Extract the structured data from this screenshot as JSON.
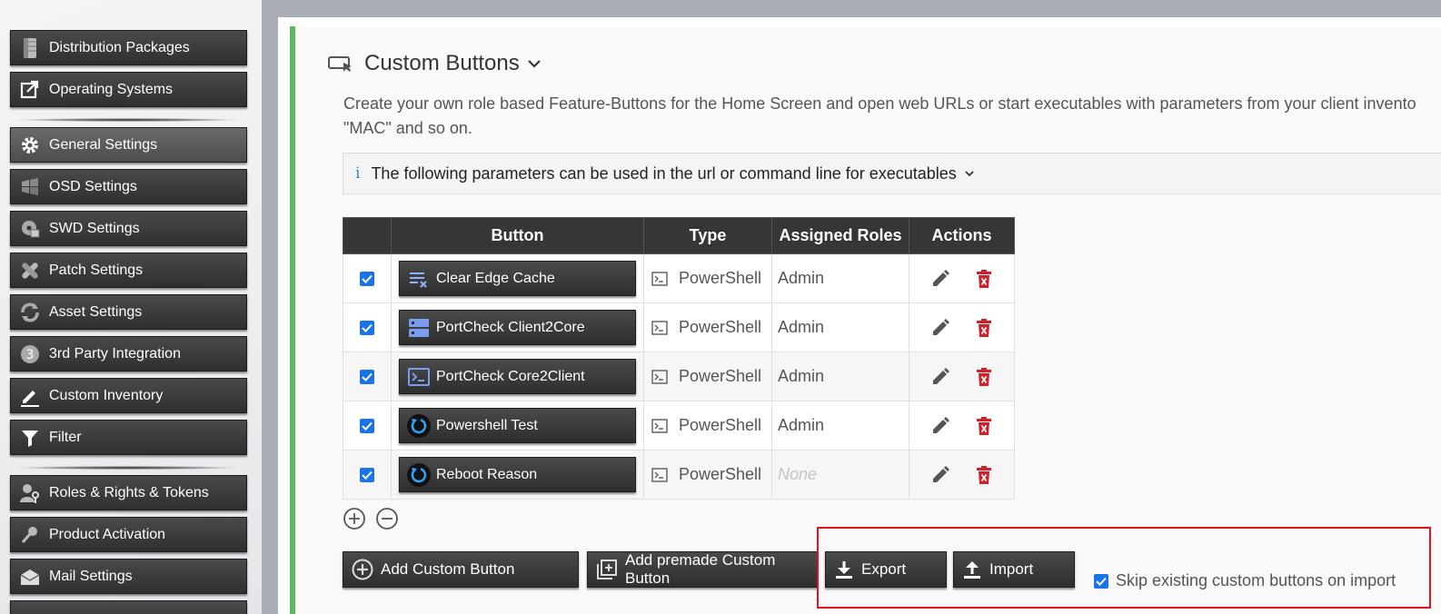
{
  "sidebar": {
    "items": [
      {
        "label": "Distribution Packages",
        "icon": "package-icon"
      },
      {
        "label": "Operating Systems",
        "icon": "external-link-icon"
      },
      {
        "label": "General Settings",
        "icon": "gear-icon"
      },
      {
        "label": "OSD Settings",
        "icon": "windows-logo-icon"
      },
      {
        "label": "SWD Settings",
        "icon": "disc-icon"
      },
      {
        "label": "Patch Settings",
        "icon": "bandage-icon"
      },
      {
        "label": "Asset Settings",
        "icon": "refresh-icon"
      },
      {
        "label": "3rd Party Integration",
        "icon": "number-three-icon"
      },
      {
        "label": "Custom Inventory",
        "icon": "pencil-icon"
      },
      {
        "label": "Filter",
        "icon": "filter-icon"
      },
      {
        "label": "Roles & Rights & Tokens",
        "icon": "user-key-icon"
      },
      {
        "label": "Product Activation",
        "icon": "key-icon"
      },
      {
        "label": "Mail Settings",
        "icon": "envelope-icon"
      }
    ]
  },
  "page": {
    "title": "Custom Buttons",
    "description_line1": "Create your own role based Feature-Buttons for the Home Screen and open web URLs or start executables with parameters from your client invento",
    "description_line2": "\"MAC\" and so on.",
    "info_text": "The following parameters can be used in the url or command line for executables",
    "info_glyph": "i"
  },
  "table": {
    "headers": [
      "",
      "Button",
      "Type",
      "Assigned Roles",
      "Actions"
    ],
    "rows": [
      {
        "button": "Clear Edge Cache",
        "icon": "clear-list-icon",
        "type": "PowerShell",
        "roles": "Admin"
      },
      {
        "button": "PortCheck Client2Core",
        "icon": "server-icon",
        "type": "PowerShell",
        "roles": "Admin"
      },
      {
        "button": "PortCheck Core2Client",
        "icon": "terminal-icon",
        "type": "PowerShell",
        "roles": "Admin"
      },
      {
        "button": "Powershell Test",
        "icon": "power-cycle-icon",
        "type": "PowerShell",
        "roles": "Admin"
      },
      {
        "button": "Reboot Reason",
        "icon": "power-cycle-icon",
        "type": "PowerShell",
        "roles": "None"
      }
    ]
  },
  "actions": {
    "add_custom": "Add Custom Button",
    "add_premade": "Add premade Custom Button",
    "export": "Export",
    "import": "Import",
    "skip_label": "Skip existing custom buttons on import"
  },
  "colors": {
    "accent_green": "#5cb85c",
    "highlight_red": "#e0141e",
    "checkbox_blue": "#1a73e8",
    "delete_red": "#d0202a"
  }
}
